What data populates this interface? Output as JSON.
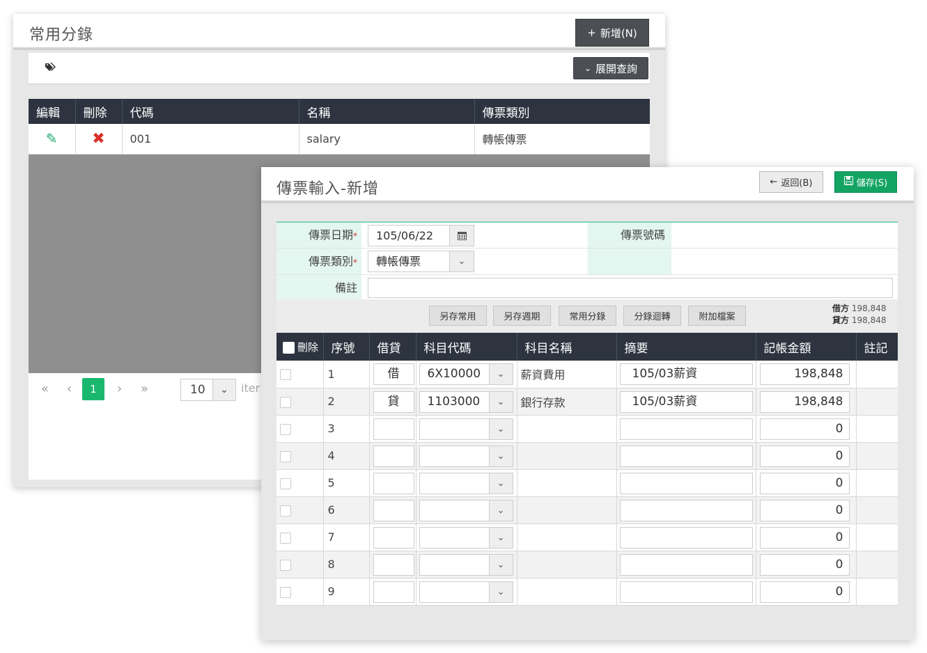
{
  "back": {
    "title": "常用分錄",
    "add_button": "新增(N)",
    "add_icon": "+",
    "expand_button": "展開查詢",
    "columns": [
      "編輯",
      "刪除",
      "代碼",
      "名稱",
      "傳票類別"
    ],
    "rows": [
      {
        "code": "001",
        "name": "salary",
        "type": "轉帳傳票"
      }
    ],
    "pager": {
      "current": "1",
      "page_size": "10",
      "items_label": "iter"
    }
  },
  "front": {
    "title": "傳票輸入-新增",
    "back_button": "返回(B)",
    "save_button": "儲存(S)",
    "form": {
      "date_label": "傳票日期",
      "date_value": "105/06/22",
      "number_label": "傳票號碼",
      "type_label": "傳票類別",
      "type_value": "轉帳傳票",
      "note_label": "備註",
      "required_mark": "*"
    },
    "actions": [
      "另存常用",
      "另存週期",
      "常用分錄",
      "分錄迴轉",
      "附加檔案"
    ],
    "totals": {
      "debit_label": "借方",
      "debit_value": "198,848",
      "credit_label": "貸方",
      "credit_value": "198,848"
    },
    "columns": [
      "刪除",
      "序號",
      "借貸",
      "科目代碼",
      "科目名稱",
      "摘要",
      "記帳金額",
      "註記"
    ],
    "rows": [
      {
        "seq": "1",
        "dc": "借",
        "code": "6X10000",
        "name": "薪資費用",
        "summary": "105/03薪資",
        "amount": "198,848"
      },
      {
        "seq": "2",
        "dc": "貸",
        "code": "1103000",
        "name": "銀行存款",
        "summary": "105/03薪資",
        "amount": "198,848"
      },
      {
        "seq": "3",
        "dc": "",
        "code": "",
        "name": "",
        "summary": "",
        "amount": "0"
      },
      {
        "seq": "4",
        "dc": "",
        "code": "",
        "name": "",
        "summary": "",
        "amount": "0"
      },
      {
        "seq": "5",
        "dc": "",
        "code": "",
        "name": "",
        "summary": "",
        "amount": "0"
      },
      {
        "seq": "6",
        "dc": "",
        "code": "",
        "name": "",
        "summary": "",
        "amount": "0"
      },
      {
        "seq": "7",
        "dc": "",
        "code": "",
        "name": "",
        "summary": "",
        "amount": "0"
      },
      {
        "seq": "8",
        "dc": "",
        "code": "",
        "name": "",
        "summary": "",
        "amount": "0"
      },
      {
        "seq": "9",
        "dc": "",
        "code": "",
        "name": "",
        "summary": "",
        "amount": "0"
      }
    ]
  },
  "icons": {
    "tag": "tags-icon",
    "pencil": "pencil-icon",
    "delete": "x-icon",
    "calendar": "calendar-icon",
    "chevron": "chevron-down-icon",
    "back": "arrow-left-icon",
    "save": "floppy-icon"
  }
}
